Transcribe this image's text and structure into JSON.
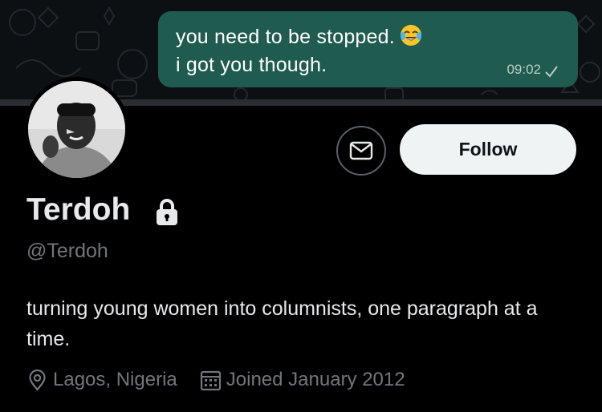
{
  "chat": {
    "message_line1": "you need to be stopped.",
    "message_line2": "i got you though.",
    "emoji": "face-with-tears-of-joy",
    "time": "09:02"
  },
  "profile": {
    "name": "Terdoh",
    "handle": "@Terdoh",
    "bio": "turning young women into columnists, one paragraph at a time.",
    "location": "Lagos, Nigeria",
    "joined": "Joined January 2012",
    "follow_label": "Follow",
    "protected": true
  },
  "icons": {
    "message": "mail-icon",
    "lock": "lock-icon",
    "location": "location-pin-icon",
    "calendar": "calendar-icon",
    "read_receipt": "checkmark-icon"
  },
  "colors": {
    "background": "#000000",
    "bubble": "#1f5b4f",
    "follow_button": "#eff3f4",
    "secondary_text": "#71767b",
    "primary_text": "#e7e9ea"
  }
}
